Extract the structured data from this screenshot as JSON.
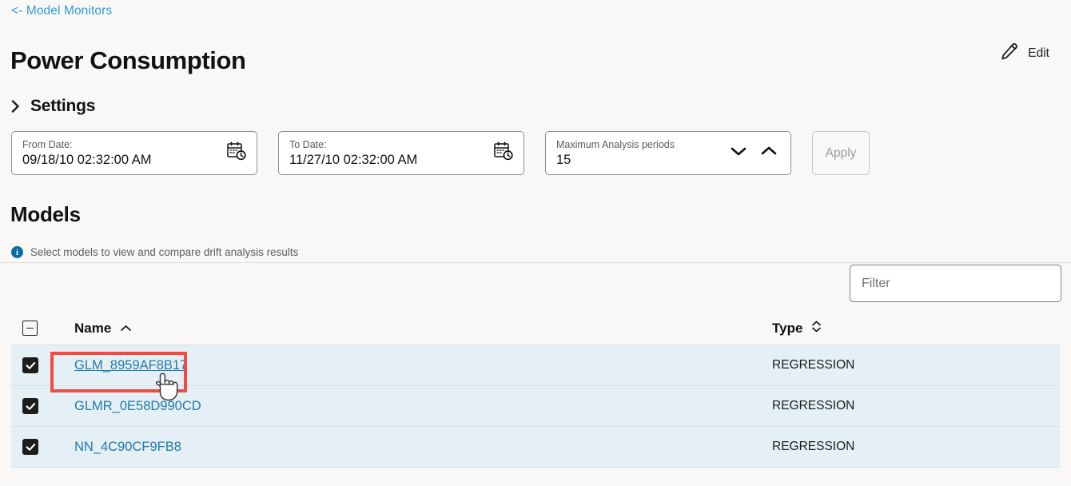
{
  "breadcrumb": {
    "label": "<- Model Monitors"
  },
  "header": {
    "title": "Power Consumption",
    "edit_label": "Edit",
    "edit_icon": "pencil-icon"
  },
  "settings": {
    "title": "Settings",
    "expand_icon": "chevron-right-icon",
    "fields": {
      "from_date": {
        "label": "From Date:",
        "value": "09/18/10 02:32:00 AM",
        "icon": "calendar-clock-icon"
      },
      "to_date": {
        "label": "To Date:",
        "value": "11/27/10 02:32:00 AM",
        "icon": "calendar-clock-icon"
      },
      "max_periods": {
        "label": "Maximum Analysis periods",
        "value": "15",
        "decrement_icon": "chevron-down-icon",
        "increment_icon": "chevron-up-icon"
      }
    },
    "apply_button": {
      "label": "Apply",
      "disabled": true
    }
  },
  "models": {
    "title": "Models",
    "hint": "Select models to view and compare drift analysis results",
    "hint_icon": "info-icon",
    "filter": {
      "placeholder": "Filter",
      "value": ""
    },
    "table": {
      "select_all_state": "indeterminate",
      "columns": [
        {
          "key": "name",
          "label": "Name",
          "sort_icon": "chevron-up-icon",
          "sort": "asc"
        },
        {
          "key": "type",
          "label": "Type",
          "sort_icon": "sort-updown-icon",
          "sort": "none"
        }
      ],
      "rows": [
        {
          "checked": true,
          "name": "GLM_8959AF8B17",
          "type": "REGRESSION",
          "hovered": true
        },
        {
          "checked": true,
          "name": "GLMR_0E58D990CD",
          "type": "REGRESSION",
          "hovered": false
        },
        {
          "checked": true,
          "name": "NN_4C90CF9FB8",
          "type": "REGRESSION",
          "hovered": false
        }
      ]
    }
  },
  "annotation": {
    "target": "GLM_8959AF8B17",
    "color": "#f04a43"
  },
  "colors": {
    "page_background": "#faf8f6",
    "link": "#2e9bd6",
    "row_background": "#e4eff6",
    "info": "#0a6ea1",
    "annotation": "#f04a43"
  }
}
